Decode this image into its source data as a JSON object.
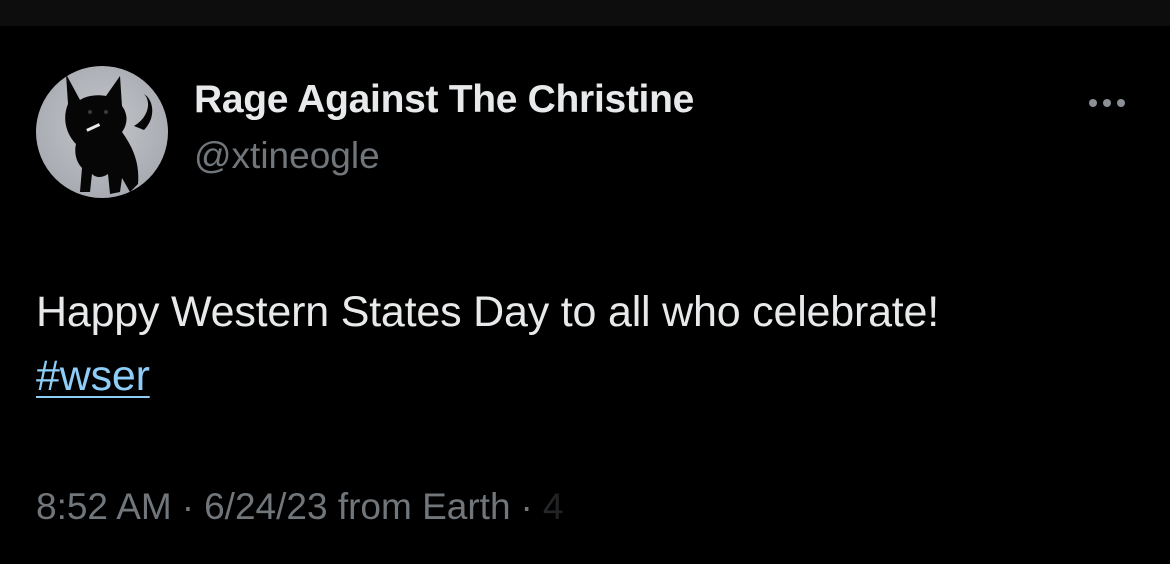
{
  "colors": {
    "background": "#000000",
    "primary_text": "#e7e9ea",
    "secondary_text": "#71767b",
    "hashtag": "#8ecdf8"
  },
  "author": {
    "display_name": "Rage Against The Christine",
    "handle": "@xtineogle",
    "avatar_icon": "black-cat-avatar"
  },
  "menu": {
    "icon": "more-horizontal-icon"
  },
  "tweet": {
    "text": "Happy Western States Day to all who celebrate!",
    "hashtag": "#wser"
  },
  "meta": {
    "time": "8:52 AM",
    "separator": "·",
    "date": "6/24/23",
    "source": "from Earth",
    "views_partial": "4"
  }
}
